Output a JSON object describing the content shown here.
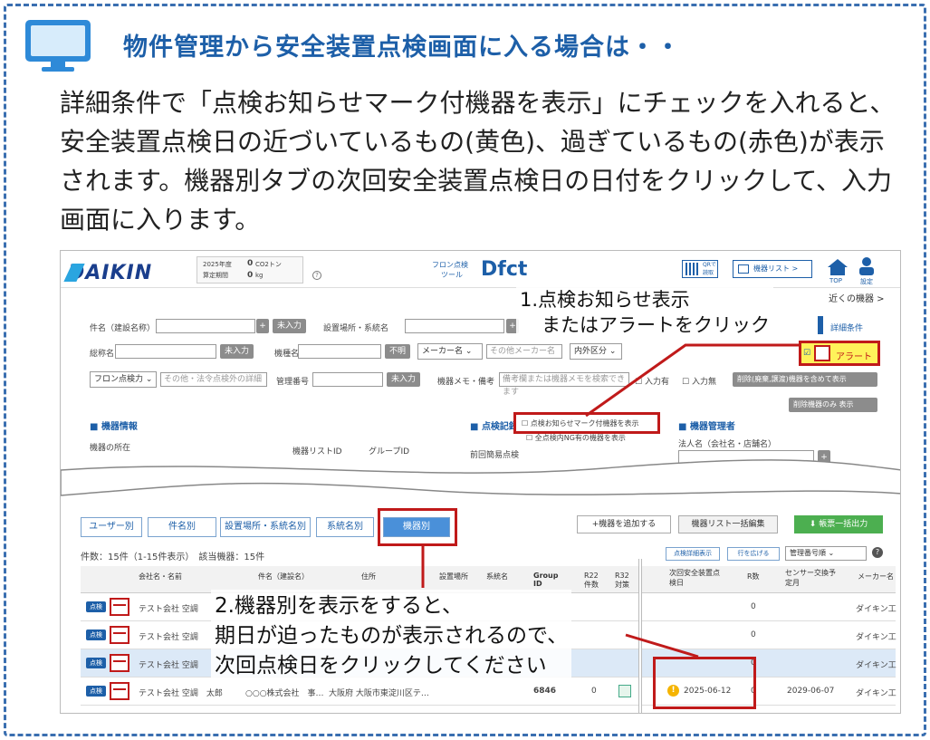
{
  "headline": "物件管理から安全装置点検画面に入る場合は・・",
  "description": "詳細条件で「点検お知らせマーク付機器を表示」にチェックを入れると、安全装置点検日の近づいているもの(黄色)、過ぎているもの(赤色)が表示されます。機器別タブの次回安全装置点検日の日付をクリックして、入力画面に入ります。",
  "app": {
    "logo": "DAIKIN",
    "year_label": "2025年度",
    "year_sub": "算定期間",
    "co2_value": "0",
    "co2_unit": "CO2トン",
    "kg_value": "0",
    "kg_unit": "kg",
    "tool_label_1": "フロン点検",
    "tool_label_2": "ツール",
    "tool_name": "Dfct",
    "qr_label": "QRで\n読取",
    "device_list_button": "機器リスト >",
    "top_label": "TOP",
    "settings_label": "設定",
    "nearby_link": "近くの機器 >",
    "detail_link": "詳細条件"
  },
  "search": {
    "property_label": "件名（建設名称）",
    "unentered_1": "未入力",
    "location_label": "設置場所・系統名",
    "company_label": "総称名",
    "unentered_2": "未入力",
    "model_label": "機種名",
    "unknown": "不明",
    "maker_select": "メーカー名",
    "other_maker_placeholder": "その他メーカー名",
    "category_select": "内外区分",
    "freon_select": "フロン点検力",
    "other_law_placeholder": "その他・法令点検外の詳細",
    "admin_no_label": "管理番号",
    "unentered_3": "未入力",
    "memo_label": "機器メモ・備考",
    "memo_placeholder": "備考欄または機器メモを検索できます",
    "input_yes": "入力有",
    "input_none": "入力無",
    "deleted_button": "削除(廃棄,譲渡)機器を含めて表示",
    "deleted_only_button": "削除機器のみ 表示",
    "alert_label": "アラート"
  },
  "sections": {
    "device_info": "機器情報",
    "device_location": "機器の所在",
    "device_list_id": "機器リストID",
    "group_id": "グループID",
    "inspection_record": "点検記録",
    "notice_checkbox": "点検お知らせマーク付機器を表示",
    "ng_checkbox": "全点検内NG有の機器を表示",
    "last_inspection": "前回簡易点検",
    "device_manager": "機器管理者",
    "corp_name": "法人名（会社名・店舗名）"
  },
  "callouts": {
    "step1_line1": "1.点検お知らせ表示",
    "step1_line2": "またはアラートをクリック",
    "step2_line1": "2.機器別を表示をすると、",
    "step2_line2": "期日が迫ったものが表示されるので、",
    "step2_line3": "次回点検日をクリックしてください"
  },
  "tabs": [
    {
      "label": "ユーザー別"
    },
    {
      "label": "件名別"
    },
    {
      "label": "設置場所・系統名別"
    },
    {
      "label": "系統名別"
    },
    {
      "label": "機器別"
    }
  ],
  "list_toolbar": {
    "add_device": "+機器を追加する",
    "bulk_edit": "機器リスト一括編集",
    "bulk_export": "帳票一括出力",
    "count_text": "件数：15件（1-15件表示）　該当機器：15件",
    "detail_display": "点検詳細表示",
    "expand_rows": "行を広げる",
    "sort_select": "管理番号順"
  },
  "table": {
    "headers": [
      "会社名・名前",
      "件名（建設名）",
      "住所",
      "設置場所",
      "系統名",
      "Group ID",
      "R22 件数",
      "R32 対策",
      "次回安全装置点検日",
      "R数",
      "センサー交換予定月",
      "メーカー名"
    ],
    "rows": [
      {
        "name": "テスト会社 空調",
        "next_date": "",
        "r_count": "0",
        "sensor": "",
        "maker": "ダイキン工"
      },
      {
        "name": "テスト会社 空調",
        "next_date": "",
        "r_count": "0",
        "sensor": "",
        "maker": "ダイキン工"
      },
      {
        "name": "テスト会社 空調",
        "next_date": "",
        "r_count": "0",
        "sensor": "",
        "maker": "ダイキン工"
      },
      {
        "name": "テスト会社 空調　太郎",
        "company": "○○○株式会社　事…",
        "address": "大阪府 大阪市東淀川区テ…",
        "group": "6846",
        "r22": "0",
        "next_date": "2025-06-12",
        "r_count": "0",
        "sensor": "2029-06-07",
        "maker": "ダイキン工"
      }
    ],
    "detail_badge": "点検"
  },
  "colors": {
    "accent": "#1d5fa8",
    "callout_red": "#c01a1a",
    "alert_yellow": "#fff25a",
    "export_green": "#4caf50"
  }
}
